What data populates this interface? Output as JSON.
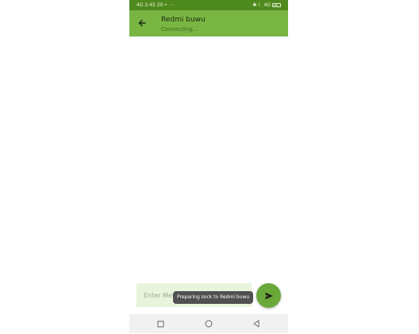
{
  "status_bar": {
    "left_text": "4G 2:45 20 • ⋯",
    "right_text": "✱ ☾ 4G"
  },
  "app_bar": {
    "title": "Redmi buwu",
    "subtitle": "Connecting..."
  },
  "composer": {
    "placeholder": "Enter Message"
  },
  "toast": {
    "text": "Preparing sock to Redmi buwu"
  },
  "icons": {
    "back": "arrow-left-icon",
    "send": "send-icon",
    "recents": "square-icon",
    "home": "circle-icon",
    "back_nav": "triangle-back-icon"
  },
  "colors": {
    "status_bar": "#4f8a1e",
    "app_bar": "#79b543",
    "input_bg": "#e8f5dc",
    "send_button": "#6aa83a",
    "toast_bg": "#505050",
    "nav_bar": "#f1f1f1"
  }
}
